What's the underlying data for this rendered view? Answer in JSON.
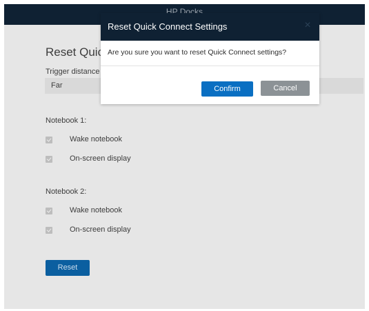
{
  "window": {
    "title": "HP Docks"
  },
  "page": {
    "heading": "Reset Quick",
    "trigger_distance_label": "Trigger distance",
    "trigger_distance_value": "Far",
    "notebook1": {
      "label": "Notebook 1:",
      "options": [
        {
          "label": "Wake notebook",
          "checked": true
        },
        {
          "label": "On-screen display",
          "checked": true
        }
      ]
    },
    "notebook2": {
      "label": "Notebook 2:",
      "options": [
        {
          "label": "Wake notebook",
          "checked": true
        },
        {
          "label": "On-screen display",
          "checked": true
        }
      ]
    },
    "reset_label": "Reset"
  },
  "dialog": {
    "title": "Reset Quick Connect Settings",
    "close_icon": "×",
    "message": "Are you sure you want to reset Quick Connect settings?",
    "confirm_label": "Confirm",
    "cancel_label": "Cancel"
  },
  "colors": {
    "title_bar": "#0f2133",
    "primary_button": "#0a6fc2",
    "secondary_button": "#8c9296",
    "window_background": "#e6e6e6"
  }
}
